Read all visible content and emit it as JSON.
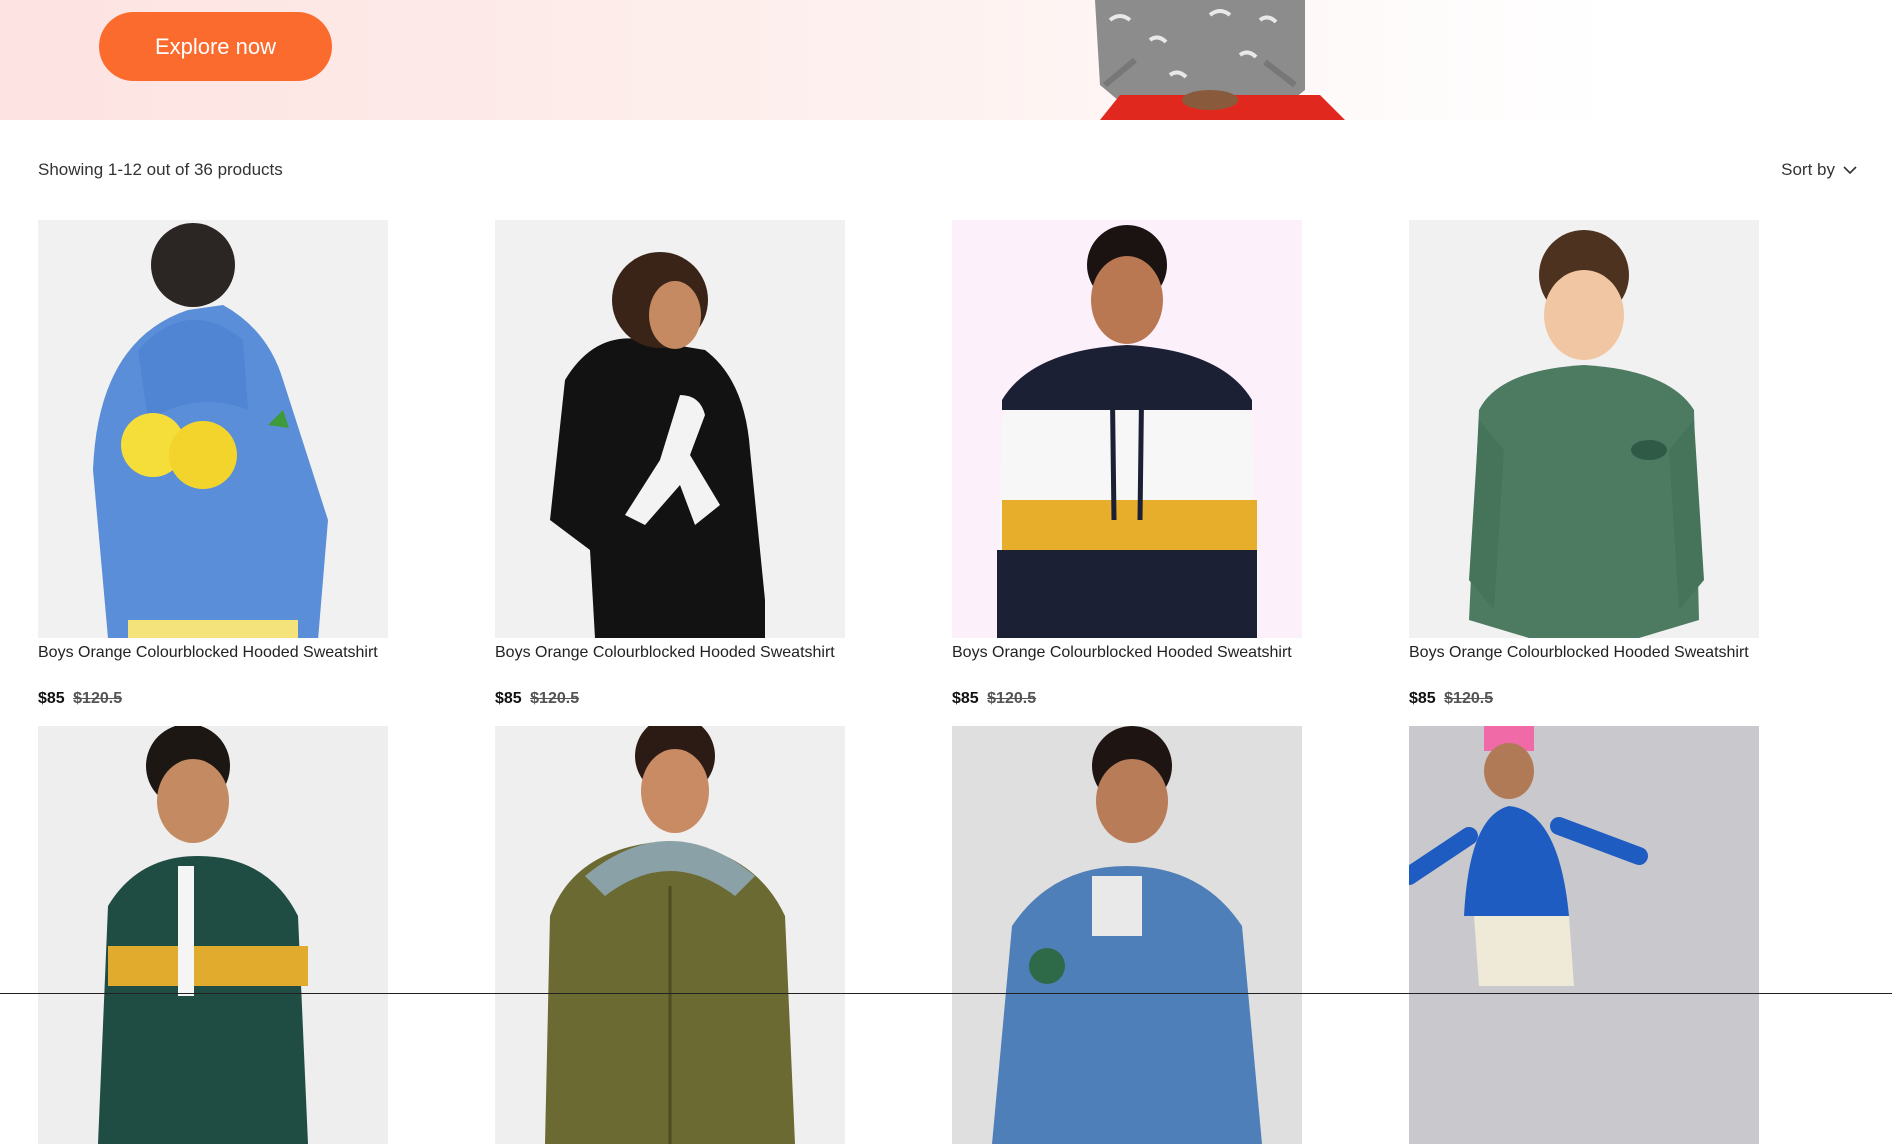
{
  "hero": {
    "cta_label": "Explore now"
  },
  "toolbar": {
    "results_text": "Showing 1-12 out of 36 products",
    "sort_label": "Sort by",
    "sort_icon": "chevron-down-icon"
  },
  "products": [
    {
      "title": "Boys Orange Colourblocked Hooded Sweatshirt",
      "price": "$85",
      "old_price": "$120.5"
    },
    {
      "title": "Boys Orange Colourblocked Hooded Sweatshirt",
      "price": "$85",
      "old_price": "$120.5"
    },
    {
      "title": "Boys Orange Colourblocked Hooded Sweatshirt",
      "price": "$85",
      "old_price": "$120.5"
    },
    {
      "title": "Boys Orange Colourblocked Hooded Sweatshirt",
      "price": "$85",
      "old_price": "$120.5"
    }
  ],
  "colors": {
    "accent": "#fa6b2d"
  }
}
